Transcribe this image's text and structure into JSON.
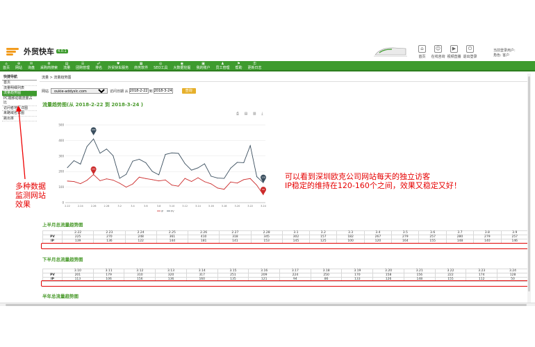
{
  "header": {
    "logo_text": "外贸快车",
    "logo_badge": "4.0.1",
    "icons": [
      {
        "name": "home-icon",
        "label": "首页",
        "glyph": "⌂"
      },
      {
        "name": "qq-icon",
        "label": "在线咨询",
        "glyph": "☺"
      },
      {
        "name": "video-icon",
        "label": "视频直播",
        "glyph": "▶"
      },
      {
        "name": "logout-icon",
        "label": "退出登录",
        "glyph": "⏻"
      }
    ],
    "user_lines": [
      "当前登录用户:",
      "角色: 客户"
    ]
  },
  "nav": [
    {
      "icon": "⌂",
      "label": "首页"
    },
    {
      "icon": "⊕",
      "label": "网站"
    },
    {
      "icon": "✉",
      "label": "询盘"
    },
    {
      "icon": "⚙",
      "label": "采购商搜索"
    },
    {
      "icon": "▤",
      "label": "流量"
    },
    {
      "icon": "☰",
      "label": "团购管理"
    },
    {
      "icon": "☍",
      "label": "排名"
    },
    {
      "icon": "♥",
      "label": "外贸快车服务"
    },
    {
      "icon": "▦",
      "label": "商务软件"
    },
    {
      "icon": "◎",
      "label": "SEO工具"
    },
    {
      "icon": "◉",
      "label": "大数据挖掘"
    },
    {
      "icon": "▣",
      "label": "我的账户"
    },
    {
      "icon": "♟",
      "label": "员工管理"
    },
    {
      "icon": "⚑",
      "label": "帮助"
    },
    {
      "icon": "⚿",
      "label": "更新日志"
    }
  ],
  "sidebar": {
    "title": "快捷导航",
    "items": [
      {
        "label": "首页",
        "active": false
      },
      {
        "label": "流量明细列表",
        "active": false
      },
      {
        "label": "流量趋势图",
        "active": true
      },
      {
        "label": "PC端移动端流量占比",
        "active": false
      },
      {
        "label": "访问者地区详图",
        "active": false
      },
      {
        "label": "来路域名详图",
        "active": false
      },
      {
        "label": "跳出率",
        "active": false
      }
    ]
  },
  "breadcrumb": "流量 > 流量趋势图",
  "filter": {
    "site_label": "网站",
    "site_value": "oukie-addyslc.com",
    "date_label": "访问日期 从",
    "date_from": "2018-2-22",
    "to_label": "到",
    "date_to": "2018-3-24",
    "query_label": "查询"
  },
  "chart_title": "流量趋势图(从 2018-2-22 到 2018-3-24 )",
  "chart_tools": "⎙ ▤ ▥ ⤓",
  "chart_data": {
    "type": "line",
    "ylim": [
      0,
      500
    ],
    "yticks": [
      "0",
      "100",
      "200",
      "300",
      "400",
      "500"
    ],
    "xticks": [
      "2.22",
      "2.24",
      "2.26",
      "2.28",
      "3.2",
      "3.4",
      "3.6",
      "3.8",
      "3.10",
      "3.12",
      "3.14",
      "3.16",
      "3.18",
      "3.20",
      "3.22",
      "3.24"
    ],
    "series": [
      {
        "name": "PV",
        "color": "#3a4e5e",
        "values": [
          225,
          270,
          248,
          361,
          410,
          318,
          345,
          302,
          157,
          182,
          267,
          279,
          257,
          201,
          179,
          310,
          320,
          317,
          251,
          209,
          224,
          250,
          170,
          158,
          156,
          222,
          259,
          257,
          367,
          167,
          128
        ]
      },
      {
        "name": "IP",
        "color": "#cc2a2a",
        "values": [
          139,
          136,
          122,
          144,
          181,
          141,
          153,
          145,
          125,
          100,
          120,
          164,
          155,
          148,
          140,
          146,
          113,
          106,
          156,
          136,
          160,
          135,
          121,
          94,
          86,
          133,
          126,
          148,
          155,
          112,
          50
        ]
      }
    ],
    "max_marker": {
      "label": "433"
    },
    "ip_max_marker": {
      "label": "181"
    },
    "end_markers": {
      "pv": "128",
      "ip": "50"
    },
    "legend": [
      "IP",
      "PV"
    ]
  },
  "annotation": {
    "line1": "可以看到深圳欧克公司网站每天的独立访客",
    "line2": "IP稳定的维持在120-160个之间，效果又稳定又好！"
  },
  "side_annotation": [
    "多种数据",
    "监测网站",
    "效果"
  ],
  "tables": [
    {
      "title": "上半月总流量趋势图",
      "dates": [
        "2.22",
        "2.23",
        "2.24",
        "2.25",
        "2.26",
        "2.27",
        "2.28",
        "3.1",
        "3.2",
        "3.3",
        "3.4",
        "3.5",
        "3.6",
        "3.7",
        "3.8",
        "3.9"
      ],
      "pv": [
        "225",
        "270",
        "248",
        "361",
        "410",
        "318",
        "345",
        "302",
        "157",
        "182",
        "267",
        "279",
        "257",
        "280",
        "279",
        "257"
      ],
      "ip": [
        "139",
        "136",
        "122",
        "144",
        "181",
        "141",
        "153",
        "145",
        "125",
        "100",
        "120",
        "164",
        "155",
        "148",
        "140",
        "146"
      ]
    },
    {
      "title": "下半月总流量趋势图",
      "dates": [
        "3.10",
        "3.11",
        "3.12",
        "3.13",
        "3.14",
        "3.15",
        "3.16",
        "3.17",
        "3.18",
        "3.19",
        "3.20",
        "3.21",
        "3.22",
        "3.23",
        "3.24"
      ],
      "pv": [
        "201",
        "179",
        "310",
        "320",
        "317",
        "251",
        "209",
        "224",
        "250",
        "170",
        "158",
        "156",
        "222",
        "174",
        "128"
      ],
      "ip": [
        "113",
        "106",
        "156",
        "136",
        "160",
        "135",
        "121",
        "94",
        "86",
        "133",
        "126",
        "148",
        "155",
        "112",
        "50"
      ]
    }
  ],
  "row_labels": {
    "pv": "PV",
    "ip": "IP"
  },
  "third_title": "半年总流量趋势图"
}
